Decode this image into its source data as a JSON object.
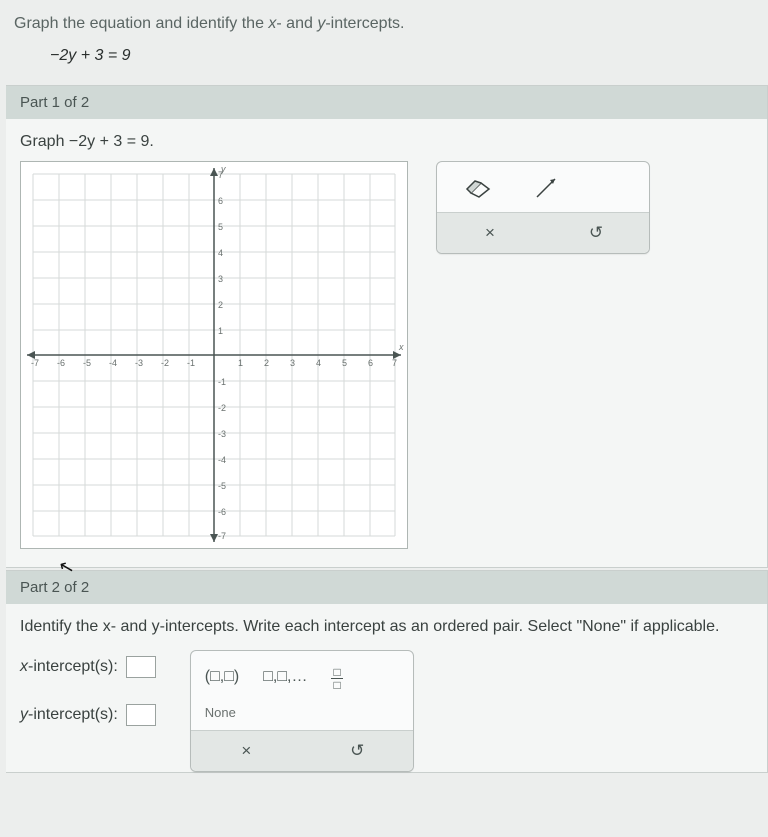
{
  "question": {
    "prompt_html": "Graph the equation and identify the <i>x</i>- and <i>y</i>-intercepts.",
    "equation": "−2y + 3 = 9"
  },
  "part1": {
    "header": "Part 1 of 2",
    "subprompt": "Graph −2y + 3 = 9."
  },
  "graph": {
    "xmin": -7,
    "xmax": 7,
    "ymin": -7,
    "ymax": 7,
    "x_ticks": [
      -7,
      -6,
      -5,
      -4,
      -3,
      -2,
      -1,
      1,
      2,
      3,
      4,
      5,
      6,
      7
    ],
    "y_ticks": [
      -7,
      -6,
      -5,
      -4,
      -3,
      -2,
      -1,
      1,
      2,
      3,
      4,
      5,
      6,
      7
    ],
    "y_axis_label": "y",
    "x_axis_label": "x"
  },
  "toolbox": {
    "eraser_label": "eraser",
    "line_label": "line",
    "clear": "×",
    "reset": "↺"
  },
  "part2": {
    "header": "Part 2 of 2",
    "prompt": "Identify the x- and y-intercepts. Write each intercept as an ordered pair. Select \"None\" if applicable.",
    "x_label": "x-intercept(s):",
    "y_label": "y-intercept(s):"
  },
  "palette": {
    "ordered_pair": "(□,□)",
    "list": "□,□,…",
    "fraction_top": "□",
    "fraction_bot": "□",
    "none": "None",
    "clear": "×",
    "reset": "↺"
  }
}
